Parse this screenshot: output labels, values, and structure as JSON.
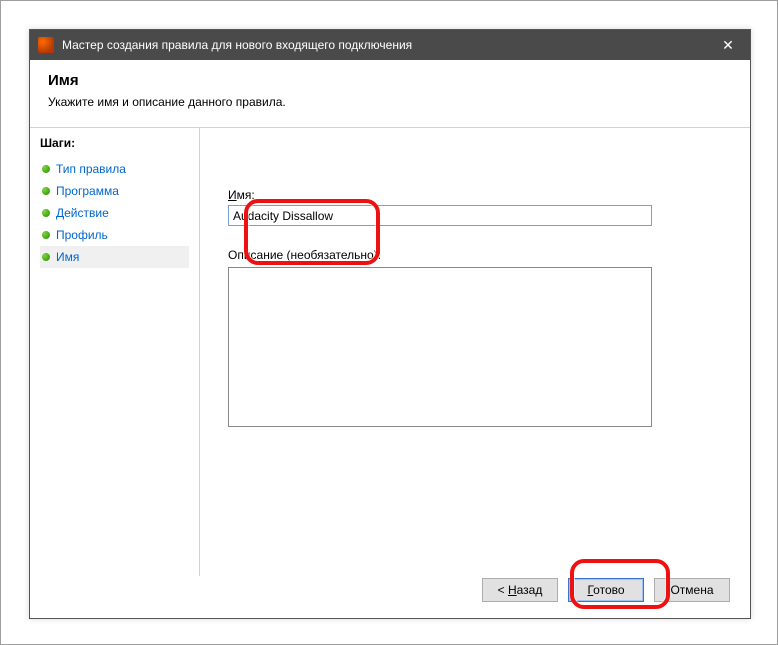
{
  "window": {
    "title": "Мастер создания правила для нового входящего подключения",
    "close_label": "✕"
  },
  "header": {
    "title": "Имя",
    "subtitle": "Укажите имя и описание данного правила."
  },
  "sidebar": {
    "title": "Шаги:",
    "items": [
      {
        "label": "Тип правила",
        "active": false
      },
      {
        "label": "Программа",
        "active": false
      },
      {
        "label": "Действие",
        "active": false
      },
      {
        "label": "Профиль",
        "active": false
      },
      {
        "label": "Имя",
        "active": true
      }
    ]
  },
  "form": {
    "name_underline": "И",
    "name_rest": "мя:",
    "name_value": "Audacity Dissallow",
    "desc_label": "Описание (необязательно):",
    "desc_value": ""
  },
  "buttons": {
    "back_prefix": "< ",
    "back_underline": "Н",
    "back_rest": "азад",
    "finish_underline": "Г",
    "finish_rest": "отово",
    "cancel": "Отмена"
  }
}
